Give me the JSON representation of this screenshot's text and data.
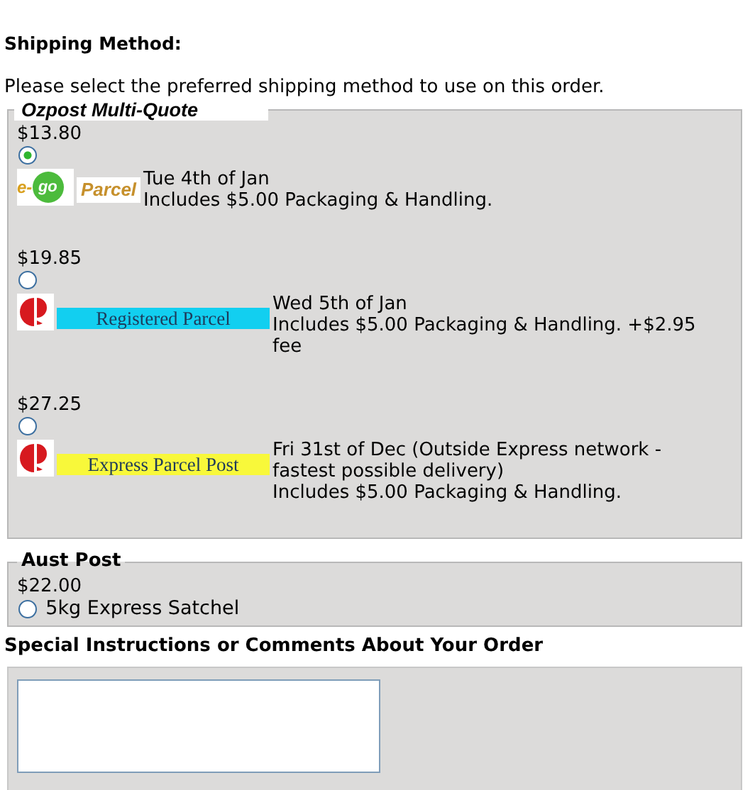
{
  "heading": "Shipping Method:",
  "intro": "Please select the preferred shipping method to use on this order.",
  "groups": [
    {
      "kind": "quotes",
      "legend": "Ozpost Multi-Quote",
      "options": [
        {
          "price": "$13.80",
          "selected": true,
          "kind": "ego",
          "logo_prefix": "e-",
          "logo_word": "go",
          "label": "Parcel",
          "details": [
            "Tue 4th of Jan",
            "Includes $5.00 Packaging & Handling."
          ]
        },
        {
          "price": "$19.85",
          "selected": false,
          "kind": "auspost",
          "label": "Registered Parcel",
          "color": "#12cff0",
          "details": [
            "Wed 5th of Jan",
            "Includes $5.00 Packaging & Handling. +$2.95 fee"
          ]
        },
        {
          "price": "$27.25",
          "selected": false,
          "kind": "auspost",
          "label": "Express Parcel Post",
          "color": "#f8f83a",
          "details": [
            "Fri 31st of Dec (Outside Express network - fastest possible delivery)",
            "Includes $5.00 Packaging & Handling."
          ]
        }
      ]
    },
    {
      "kind": "simple",
      "legend": "Aust Post",
      "options": [
        {
          "price": "$22.00",
          "selected": false,
          "label": "5kg Express Satchel"
        }
      ]
    }
  ],
  "comments": {
    "heading": "Special Instructions or Comments About Your Order"
  }
}
